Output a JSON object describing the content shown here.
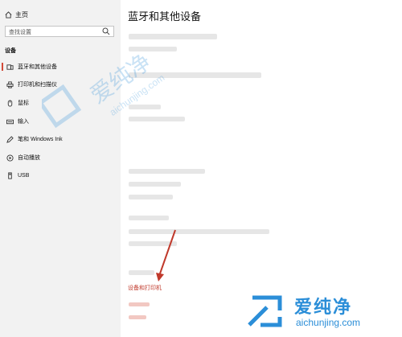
{
  "sidebar": {
    "home_label": "主页",
    "search_placeholder": "查找设置",
    "section_label": "设备",
    "items": [
      {
        "label": "蓝牙和其他设备",
        "icon": "bluetooth-devices-icon"
      },
      {
        "label": "打印机和扫描仪",
        "icon": "printer-icon"
      },
      {
        "label": "鼠标",
        "icon": "mouse-icon"
      },
      {
        "label": "输入",
        "icon": "keyboard-icon"
      },
      {
        "label": "笔和 Windows Ink",
        "icon": "pen-icon"
      },
      {
        "label": "自动播放",
        "icon": "autoplay-icon"
      },
      {
        "label": "USB",
        "icon": "usb-icon"
      }
    ]
  },
  "main": {
    "title": "蓝牙和其他设备",
    "link_label": "设备和打印机"
  },
  "watermark": {
    "brand": "爱纯净",
    "url": "aichunjing.com",
    "color": "#2b8ed8"
  },
  "colors": {
    "accent": "#d24a39",
    "link": "#c0392b",
    "arrow": "#c0392b"
  }
}
